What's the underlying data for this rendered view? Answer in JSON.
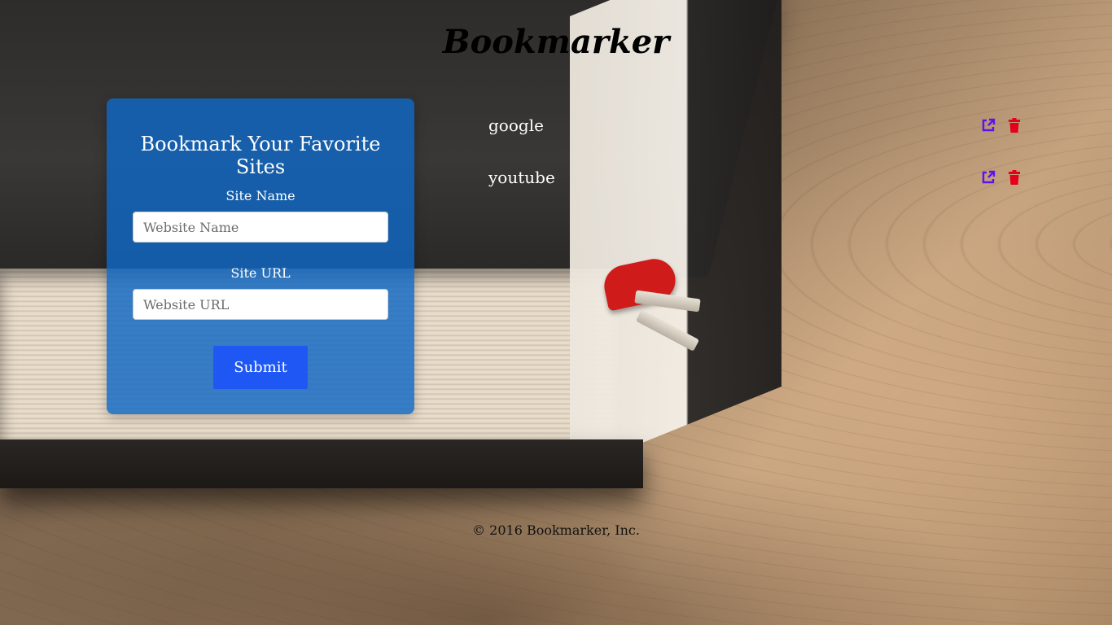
{
  "app": {
    "title": "Bookmarker"
  },
  "form": {
    "heading": "Bookmark Your Favorite Sites",
    "site_name_label": "Site Name",
    "site_name_placeholder": "Website Name",
    "site_name_value": "",
    "site_url_label": "Site URL",
    "site_url_placeholder": "Website URL",
    "site_url_value": "",
    "submit_label": "Submit"
  },
  "bookmarks": [
    {
      "name": "google",
      "visit_icon": "external-link-icon",
      "delete_icon": "trash-icon"
    },
    {
      "name": "youtube",
      "visit_icon": "external-link-icon",
      "delete_icon": "trash-icon"
    }
  ],
  "footer": {
    "text": "© 2016 Bookmarker, Inc."
  },
  "colors": {
    "card_bg": "#1068c4",
    "submit_bg": "#1f57f5",
    "visit_icon": "#5a12f0",
    "delete_icon": "#e3001b"
  }
}
